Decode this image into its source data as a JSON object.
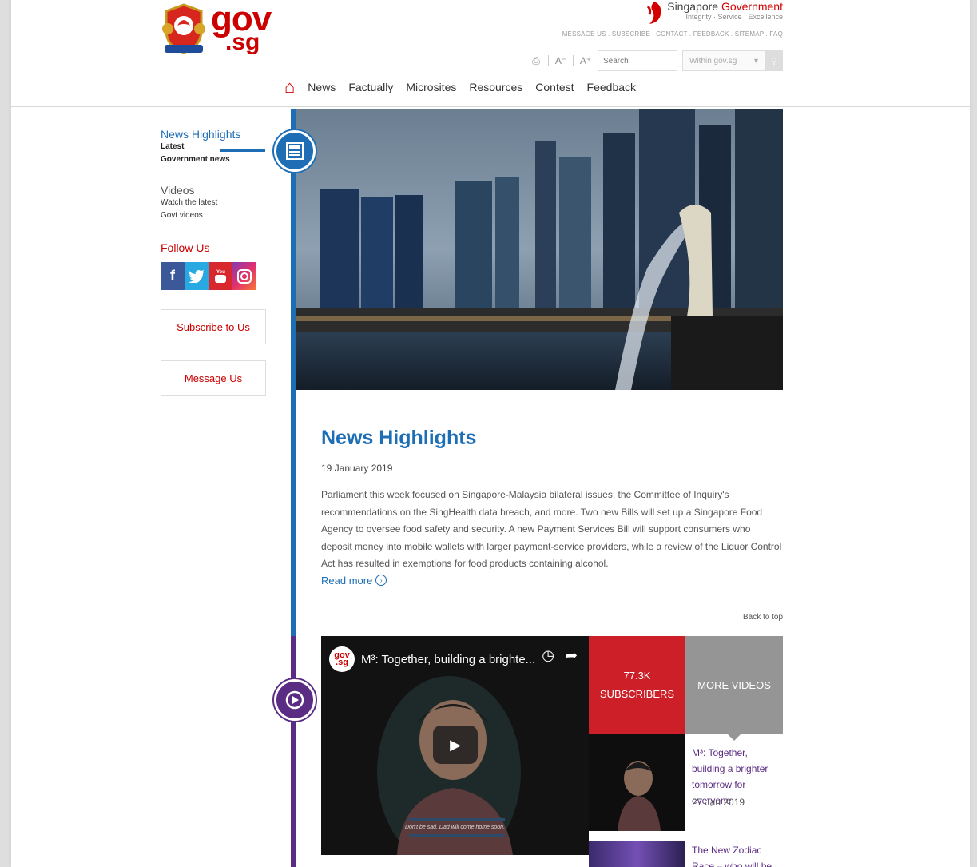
{
  "header": {
    "logo_gov": "gov",
    "logo_sg": ".sg",
    "sg_gov_title_part1": "Singapore ",
    "sg_gov_title_part2": "Government",
    "sg_gov_tagline": "Integrity · Service · Excellence",
    "util_links": "MESSAGE US . SUBSCRIBE . CONTACT . FEEDBACK . SITEMAP . FAQ",
    "search_placeholder": "Search",
    "search_scope": "Within gov.sg",
    "font_decrease": "A⁻",
    "font_increase": "A⁺"
  },
  "nav": {
    "items": [
      "News",
      "Factually",
      "Microsites",
      "Resources",
      "Contest",
      "Feedback"
    ]
  },
  "sidebar": {
    "news_title": "News Highlights",
    "news_sub1": "Latest",
    "news_sub2": "Government news",
    "videos_title": "Videos",
    "videos_sub1": "Watch the latest",
    "videos_sub2": "Govt videos",
    "follow_title": "Follow Us",
    "subscribe_label": "Subscribe to Us",
    "message_label": "Message Us"
  },
  "article": {
    "title": "News Highlights",
    "date": "19 January 2019",
    "body": "Parliament this week focused on Singapore-Malaysia bilateral issues, the Committee of Inquiry's recommendations on the SingHealth data breach, and more. Two new Bills will set up a Singapore Food Agency to oversee food safety and security. A new Payment Services Bill will support consumers who deposit money into mobile wallets with larger payment-service providers, while a review of the Liquor Control Act has resulted in exemptions for food products containing alcohol.",
    "read_more": "Read more",
    "back_to_top": "Back to top"
  },
  "video": {
    "logo_text": "gov .sg",
    "title": "M³: Together, building a brighte...",
    "caption": "Don't be sad. Dad will come home soon.",
    "subscribers_count": "77.3K",
    "subscribers_label": "SUBSCRIBERS",
    "more_videos_label": "MORE VIDEOS",
    "list": [
      {
        "title": "M³: Together, building a brighter tomorrow for everyone",
        "date": "27 Jan 2019"
      },
      {
        "title": "The New Zodiac Race – who will be the"
      }
    ]
  },
  "colors": {
    "brand_red": "#cc0000",
    "accent_blue": "#1e6eb5",
    "video_purple": "#5b2c83"
  }
}
